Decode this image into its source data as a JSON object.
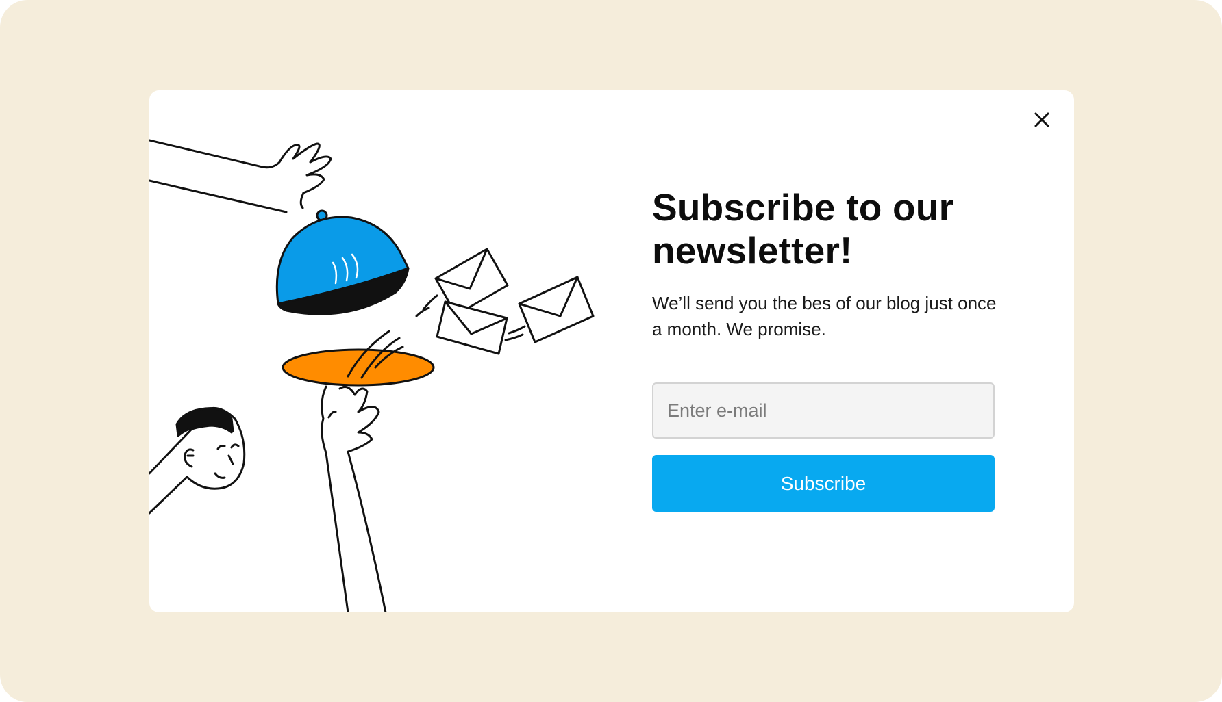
{
  "modal": {
    "title_line1": "Subscribe to our",
    "title_line2": "newsletter!",
    "subtitle": "We’ll send you the bes of our blog just once a month. We promise.",
    "email_placeholder": "Enter e-mail",
    "email_value": "",
    "subscribe_label": "Subscribe"
  },
  "icons": {
    "close": "close-icon",
    "illustration": "newsletter-cloche-illustration"
  },
  "colors": {
    "background": "#f5eddb",
    "accent": "#08a9f0",
    "cloche_blue": "#0a9be8",
    "plate_orange": "#ff8c00"
  }
}
